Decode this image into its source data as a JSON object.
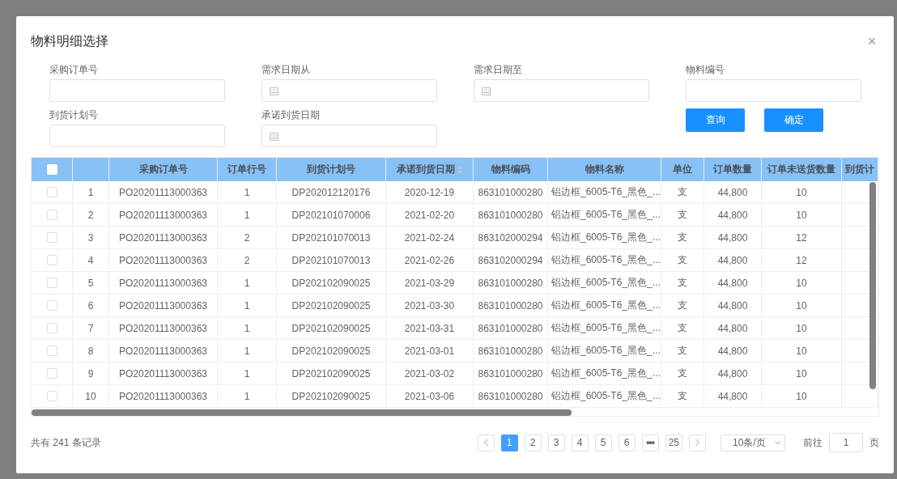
{
  "dialog": {
    "title": "物料明细选择",
    "close": "×"
  },
  "filters": [
    {
      "label": "采购订单号",
      "kind": "text"
    },
    {
      "label": "需求日期从",
      "kind": "date"
    },
    {
      "label": "需求日期至",
      "kind": "date"
    },
    {
      "label": "物料编号",
      "kind": "text"
    },
    {
      "label": "到货计划号",
      "kind": "text"
    },
    {
      "label": "承诺到货日期",
      "kind": "date"
    }
  ],
  "buttons": [
    "查询",
    "确定"
  ],
  "table": {
    "select_all": {
      "checked": false
    },
    "columns": [
      {
        "label": "采购订单号",
        "sortable": false
      },
      {
        "label": "订单行号",
        "sortable": false
      },
      {
        "label": "到货计划号",
        "sortable": false
      },
      {
        "label": "承诺到货日期",
        "sortable": true
      },
      {
        "label": "物料编码",
        "sortable": false
      },
      {
        "label": "物料名称",
        "sortable": false
      },
      {
        "label": "单位",
        "sortable": false
      },
      {
        "label": "订单数量",
        "sortable": false
      },
      {
        "label": "订单未送货数量",
        "sortable": false
      },
      {
        "label": "到货计",
        "sortable": false
      }
    ],
    "rows": [
      {
        "checked": false,
        "index": "1",
        "cells": [
          "PO20201113000363",
          "1",
          "DP202012120176",
          "2020-12-19",
          "863101000280",
          "铝边框_6005-T6_黑色_...",
          "支",
          "44,800",
          "10"
        ]
      },
      {
        "checked": false,
        "index": "2",
        "cells": [
          "PO20201113000363",
          "1",
          "DP202101070006",
          "2021-02-20",
          "863101000280",
          "铝边框_6005-T6_黑色_...",
          "支",
          "44,800",
          "10"
        ]
      },
      {
        "checked": false,
        "index": "3",
        "cells": [
          "PO20201113000363",
          "2",
          "DP202101070013",
          "2021-02-24",
          "863102000294",
          "铝边框_6005-T6_黑色_...",
          "支",
          "44,800",
          "12"
        ]
      },
      {
        "checked": false,
        "index": "4",
        "cells": [
          "PO20201113000363",
          "2",
          "DP202101070013",
          "2021-02-26",
          "863102000294",
          "铝边框_6005-T6_黑色_...",
          "支",
          "44,800",
          "12"
        ]
      },
      {
        "checked": false,
        "index": "5",
        "cells": [
          "PO20201113000363",
          "1",
          "DP202102090025",
          "2021-03-29",
          "863101000280",
          "铝边框_6005-T6_黑色_...",
          "支",
          "44,800",
          "10"
        ]
      },
      {
        "checked": false,
        "index": "6",
        "cells": [
          "PO20201113000363",
          "1",
          "DP202102090025",
          "2021-03-30",
          "863101000280",
          "铝边框_6005-T6_黑色_...",
          "支",
          "44,800",
          "10"
        ]
      },
      {
        "checked": false,
        "index": "7",
        "cells": [
          "PO20201113000363",
          "1",
          "DP202102090025",
          "2021-03-31",
          "863101000280",
          "铝边框_6005-T6_黑色_...",
          "支",
          "44,800",
          "10"
        ]
      },
      {
        "checked": false,
        "index": "8",
        "cells": [
          "PO20201113000363",
          "1",
          "DP202102090025",
          "2021-03-01",
          "863101000280",
          "铝边框_6005-T6_黑色_...",
          "支",
          "44,800",
          "10"
        ]
      },
      {
        "checked": false,
        "index": "9",
        "cells": [
          "PO20201113000363",
          "1",
          "DP202102090025",
          "2021-03-02",
          "863101000280",
          "铝边框_6005-T6_黑色_...",
          "支",
          "44,800",
          "10"
        ]
      },
      {
        "checked": false,
        "index": "10",
        "cells": [
          "PO20201113000363",
          "1",
          "DP202102090025",
          "2021-03-06",
          "863101000280",
          "铝边框_6005-T6_黑色_...",
          "支",
          "44,800",
          "10"
        ]
      }
    ]
  },
  "pagination": {
    "total": "共有 241 条记录",
    "pages": [
      {
        "label": "1",
        "selected": true,
        "kind": "page"
      },
      {
        "label": "2",
        "selected": false,
        "kind": "page"
      },
      {
        "label": "3",
        "selected": false,
        "kind": "page"
      },
      {
        "label": "4",
        "selected": false,
        "kind": "page"
      },
      {
        "label": "5",
        "selected": false,
        "kind": "page"
      },
      {
        "label": "6",
        "selected": false,
        "kind": "page"
      },
      {
        "label": "•••",
        "selected": false,
        "kind": "more"
      },
      {
        "label": "25",
        "selected": false,
        "kind": "page"
      }
    ],
    "page_size": "10条/页",
    "goto_label": "前往",
    "goto_value": "1",
    "goto_suffix": "页"
  }
}
